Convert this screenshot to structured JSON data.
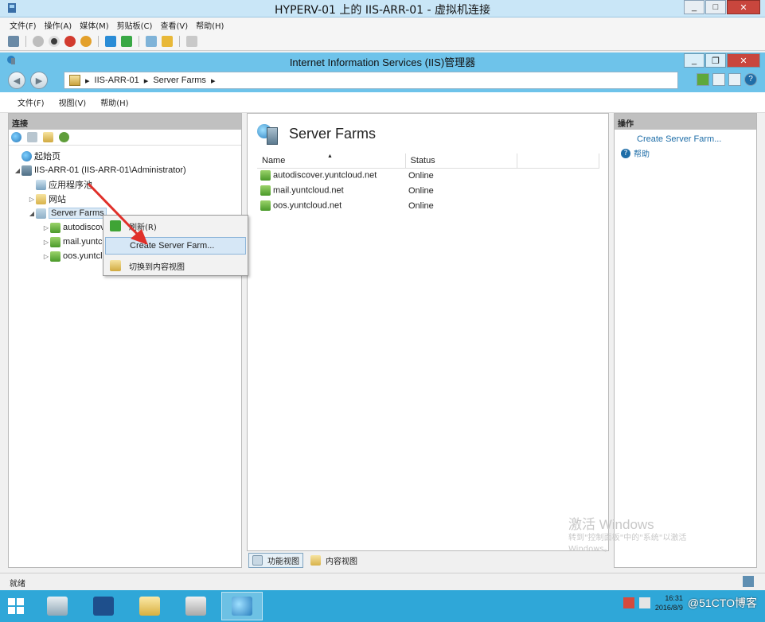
{
  "vm_window": {
    "title": "HYPERV-01 上的 IIS-ARR-01 - 虚拟机连接",
    "menu": [
      "文件(F)",
      "操作(A)",
      "媒体(M)",
      "剪贴板(C)",
      "查看(V)",
      "帮助(H)"
    ],
    "buttons": {
      "minimize": "_",
      "restore": "□",
      "close": "✕"
    }
  },
  "iis_window": {
    "title": "Internet Information Services (IIS)管理器",
    "buttons": {
      "minimize": "_",
      "restore": "❐",
      "close": "✕"
    },
    "address": {
      "segments": [
        "IIS-ARR-01",
        "Server Farms"
      ],
      "separator": "▸"
    },
    "menu": [
      "文件(F)",
      "视图(V)",
      "帮助(H)"
    ]
  },
  "connections": {
    "header": "连接",
    "tree": [
      {
        "label": "起始页",
        "level": 0,
        "toggle": "",
        "icon": "start-page-icon"
      },
      {
        "label": "IIS-ARR-01 (IIS-ARR-01\\Administrator)",
        "level": 0,
        "toggle": "◢",
        "icon": "server-icon"
      },
      {
        "label": "应用程序池",
        "level": 1,
        "toggle": "",
        "icon": "app-pool-icon"
      },
      {
        "label": "网站",
        "level": 1,
        "toggle": "▷",
        "icon": "sites-folder-icon"
      },
      {
        "label": "Server Farms",
        "level": 1,
        "toggle": "◢",
        "icon": "server-farms-icon",
        "selected": true
      },
      {
        "label": "autodiscover.yuntcloud.net",
        "level": 2,
        "toggle": "▷",
        "icon": "farm-icon"
      },
      {
        "label": "mail.yuntcloud.net",
        "level": 2,
        "toggle": "▷",
        "icon": "farm-icon"
      },
      {
        "label": "oos.yuntcloud.net",
        "level": 2,
        "toggle": "▷",
        "icon": "farm-icon"
      }
    ]
  },
  "context_menu": {
    "items": [
      {
        "label": "刷新(R)",
        "icon": "refresh-icon",
        "highlighted": false
      },
      {
        "label": "Create Server Farm...",
        "icon": "",
        "highlighted": true
      },
      {
        "label": "切换到内容视图",
        "icon": "content-view-icon",
        "highlighted": false
      }
    ]
  },
  "center": {
    "title": "Server Farms",
    "columns": [
      "Name",
      "Status"
    ],
    "rows": [
      {
        "name": "autodiscover.yuntcloud.net",
        "status": "Online"
      },
      {
        "name": "mail.yuntcloud.net",
        "status": "Online"
      },
      {
        "name": "oos.yuntcloud.net",
        "status": "Online"
      }
    ],
    "view_tabs": [
      "功能视图",
      "内容视图"
    ]
  },
  "actions": {
    "header": "操作",
    "create_link": "Create Server Farm...",
    "help": "帮助"
  },
  "watermark": {
    "line1": "激活 Windows",
    "line2": "转到\"控制面板\"中的\"系统\"以激活",
    "line3": "Windows。"
  },
  "status": {
    "text": "就绪"
  },
  "taskbar": {
    "time": "16:31",
    "date": "2016/8/9",
    "credit": "@51CTO博客"
  },
  "colors": {
    "vm_title_bg": "#c9e6f7",
    "iis_title_bg": "#6ec3ea",
    "taskbar_bg": "#2fa7d8",
    "link": "#1f6ea8",
    "annotation_arrow": "#e0302a"
  }
}
